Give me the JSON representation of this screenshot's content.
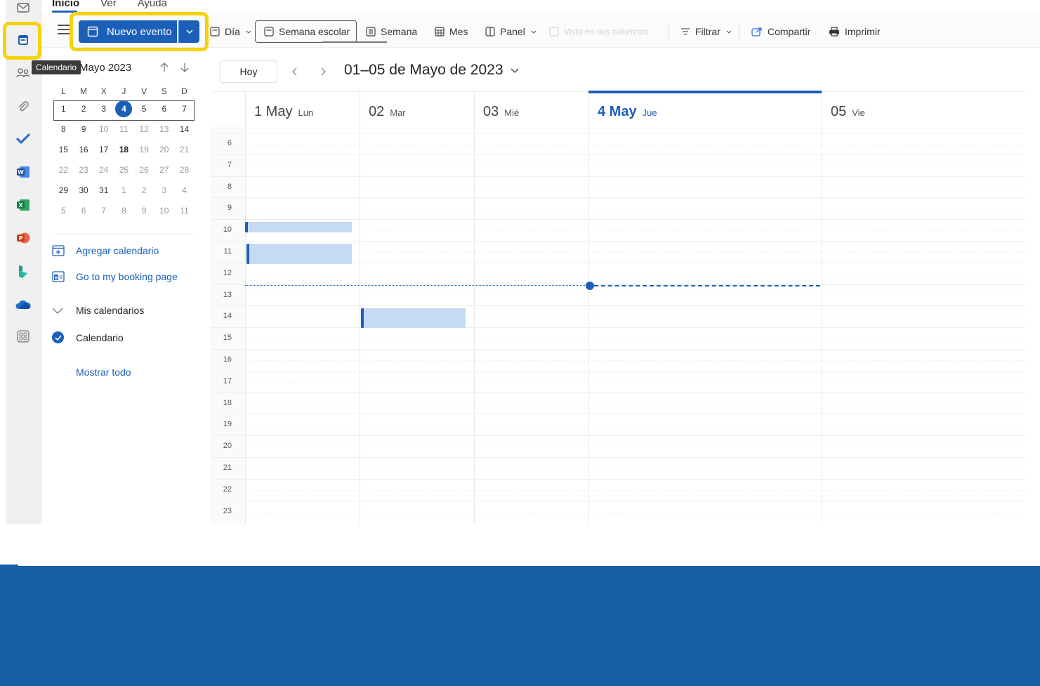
{
  "tooltip": "Calendario",
  "menu": {
    "tabs": [
      "Inicio",
      "Ver",
      "Ayuda"
    ]
  },
  "ribbon": {
    "new_event": "Nuevo evento",
    "day": "Día",
    "school_week": "Semana escolar",
    "week": "Semana",
    "month": "Mes",
    "panel": "Panel",
    "split_view": "Vista en dos columnas",
    "filter": "Filtrar",
    "share": "Compartir",
    "print": "Imprimir"
  },
  "mini_calendar": {
    "title": "Mayo 2023",
    "weekdays": [
      "L",
      "M",
      "X",
      "J",
      "V",
      "S",
      "D"
    ],
    "weeks": [
      [
        "1",
        "2",
        "3",
        "4",
        "5",
        "6",
        "7"
      ],
      [
        "8",
        "9",
        "10",
        "11",
        "12",
        "13",
        "14"
      ],
      [
        "15",
        "16",
        "17",
        "18",
        "19",
        "20",
        "21"
      ],
      [
        "22",
        "23",
        "24",
        "25",
        "26",
        "27",
        "28"
      ],
      [
        "29",
        "30",
        "31",
        "1",
        "2",
        "3",
        "4"
      ],
      [
        "5",
        "6",
        "7",
        "8",
        "9",
        "10",
        "11"
      ]
    ],
    "today": "4"
  },
  "left_pane": {
    "add_calendar": "Agregar calendario",
    "booking": "Go to my booking page",
    "my_calendars": "Mis calendarios",
    "calendar": "Calendario",
    "show_all": "Mostrar todo"
  },
  "toolbar": {
    "today": "Hoy",
    "range": "01–05 de Mayo de 2023"
  },
  "days": [
    {
      "num": "1 May",
      "name": "Lun"
    },
    {
      "num": "02",
      "name": "Mar"
    },
    {
      "num": "03",
      "name": "Mié"
    },
    {
      "num": "4 May",
      "name": "Jue"
    },
    {
      "num": "05",
      "name": "Vie"
    }
  ],
  "hours": [
    "6",
    "7",
    "8",
    "9",
    "10",
    "11",
    "12",
    "13",
    "14",
    "15",
    "16",
    "17",
    "18",
    "19",
    "20",
    "21",
    "22",
    "23"
  ],
  "colors": {
    "accent": "#1b5fb8",
    "highlight": "#f5d20d",
    "event": "#c7daf3",
    "band": "#145fa5"
  }
}
